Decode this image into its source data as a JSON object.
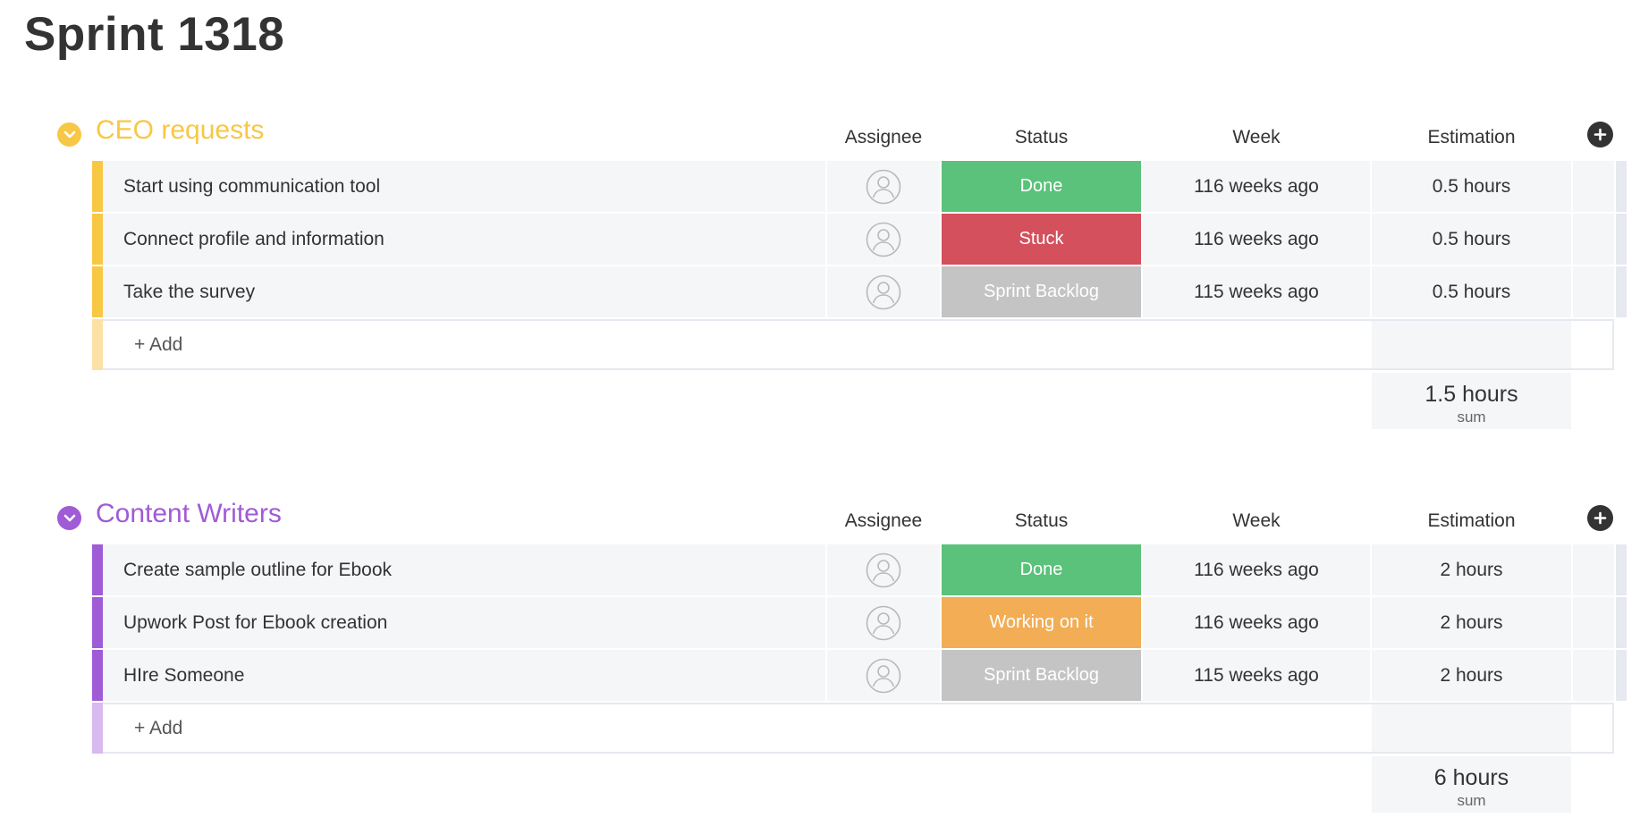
{
  "page": {
    "title": "Sprint 1318"
  },
  "columns": {
    "assignee": "Assignee",
    "status": "Status",
    "week": "Week",
    "estimation": "Estimation"
  },
  "colors": {
    "done": "#5ac27a",
    "stuck": "#d3505c",
    "working": "#f2ad55",
    "backlog": "#c4c4c4",
    "ceo_group": "#f8c744",
    "ceo_add_strip": "#fbe1a6",
    "content_group": "#a05bd6",
    "content_add_strip": "#d6baf0"
  },
  "groups": [
    {
      "title": "CEO requests",
      "add_label": "+ Add",
      "sum": {
        "value": "1.5 hours",
        "label": "sum"
      },
      "items": [
        {
          "name": "Start using communication tool",
          "status": "Done",
          "week": "116 weeks ago",
          "estimation": "0.5 hours"
        },
        {
          "name": "Connect profile and information",
          "status": "Stuck",
          "week": "116 weeks ago",
          "estimation": "0.5 hours"
        },
        {
          "name": "Take the survey",
          "status": "Sprint Backlog",
          "week": "115 weeks ago",
          "estimation": "0.5 hours"
        }
      ]
    },
    {
      "title": "Content Writers",
      "add_label": "+ Add",
      "sum": {
        "value": "6 hours",
        "label": "sum"
      },
      "items": [
        {
          "name": "Create sample outline for Ebook",
          "status": "Done",
          "week": "116 weeks ago",
          "estimation": "2 hours"
        },
        {
          "name": "Upwork Post for Ebook creation",
          "status": "Working on it",
          "week": "116 weeks ago",
          "estimation": "2 hours"
        },
        {
          "name": "HIre Someone",
          "status": "Sprint Backlog",
          "week": "115 weeks ago",
          "estimation": "2 hours"
        }
      ]
    }
  ]
}
